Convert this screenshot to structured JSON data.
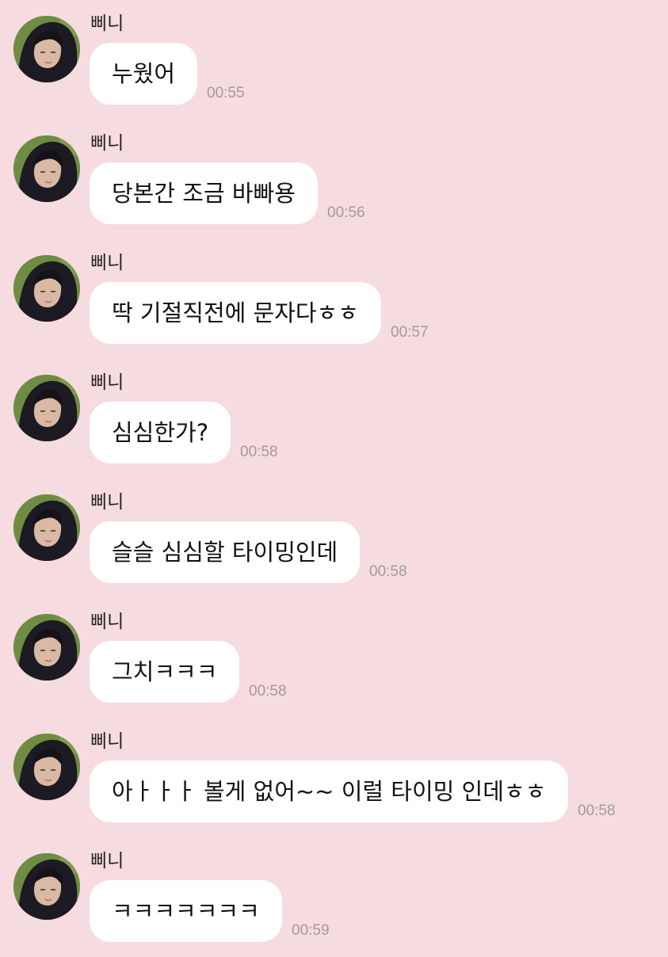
{
  "chat": {
    "background_color": "#f6dbe0",
    "messages": [
      {
        "sender": "삐니",
        "text": "누웠어",
        "time": "00:55"
      },
      {
        "sender": "삐니",
        "text": "당본간 조금 바빠용",
        "time": "00:56"
      },
      {
        "sender": "삐니",
        "text": "딱 기절직전에 문자다ㅎㅎ",
        "time": "00:57"
      },
      {
        "sender": "삐니",
        "text": "심심한가?",
        "time": "00:58"
      },
      {
        "sender": "삐니",
        "text": "슬슬 심심할 타이밍인데",
        "time": "00:58"
      },
      {
        "sender": "삐니",
        "text": "그치ㅋㅋㅋ",
        "time": "00:58"
      },
      {
        "sender": "삐니",
        "text": "아ㅏㅏㅏ 볼게 없어~~ 이럴 타이밍 인데ㅎㅎ",
        "time": "00:58"
      },
      {
        "sender": "삐니",
        "text": "ㅋㅋㅋㅋㅋㅋㅋ",
        "time": "00:59"
      }
    ]
  }
}
